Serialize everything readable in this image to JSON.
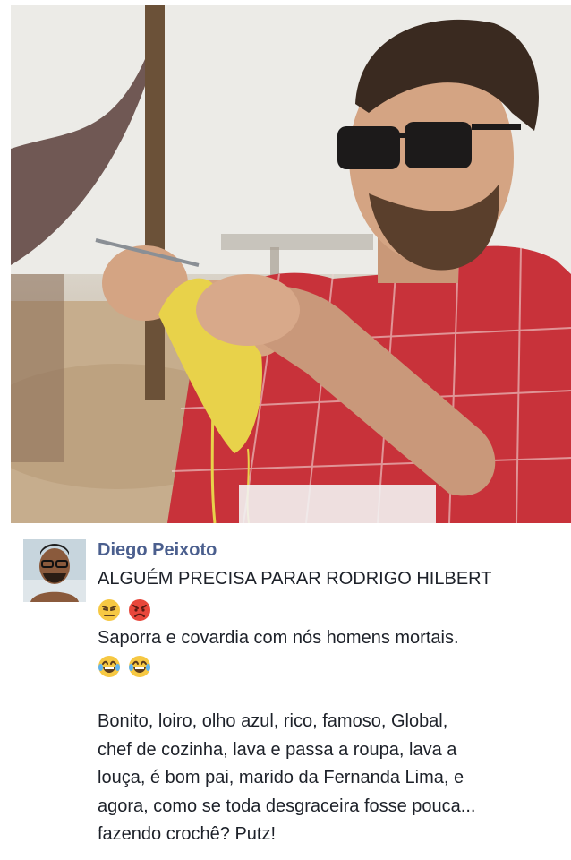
{
  "post": {
    "author": "Diego Peixoto",
    "line1": "ALGUÉM PRECISA PARAR RODRIGO HILBERT",
    "emojis_after_line1": [
      "unamused-face-icon",
      "pouting-face-icon"
    ],
    "line2": "Saporra e covardia com nós homens mortais.",
    "emojis_after_line2": [
      "tears-of-joy-icon",
      "tears-of-joy-icon"
    ],
    "body_lines": [
      "Bonito, loiro, olho azul, rico, famoso, Global,",
      "chef de cozinha, lava e passa a roupa, lava a",
      "louça, é bom pai, marido da Fernanda Lima, e",
      "agora, como se toda desgraceira fosse pouca...",
      "fazendo crochê? Putz!"
    ]
  },
  "colors": {
    "author_name": "#4b5f8e",
    "text": "#1d2129",
    "shirt": "#c8323a"
  }
}
